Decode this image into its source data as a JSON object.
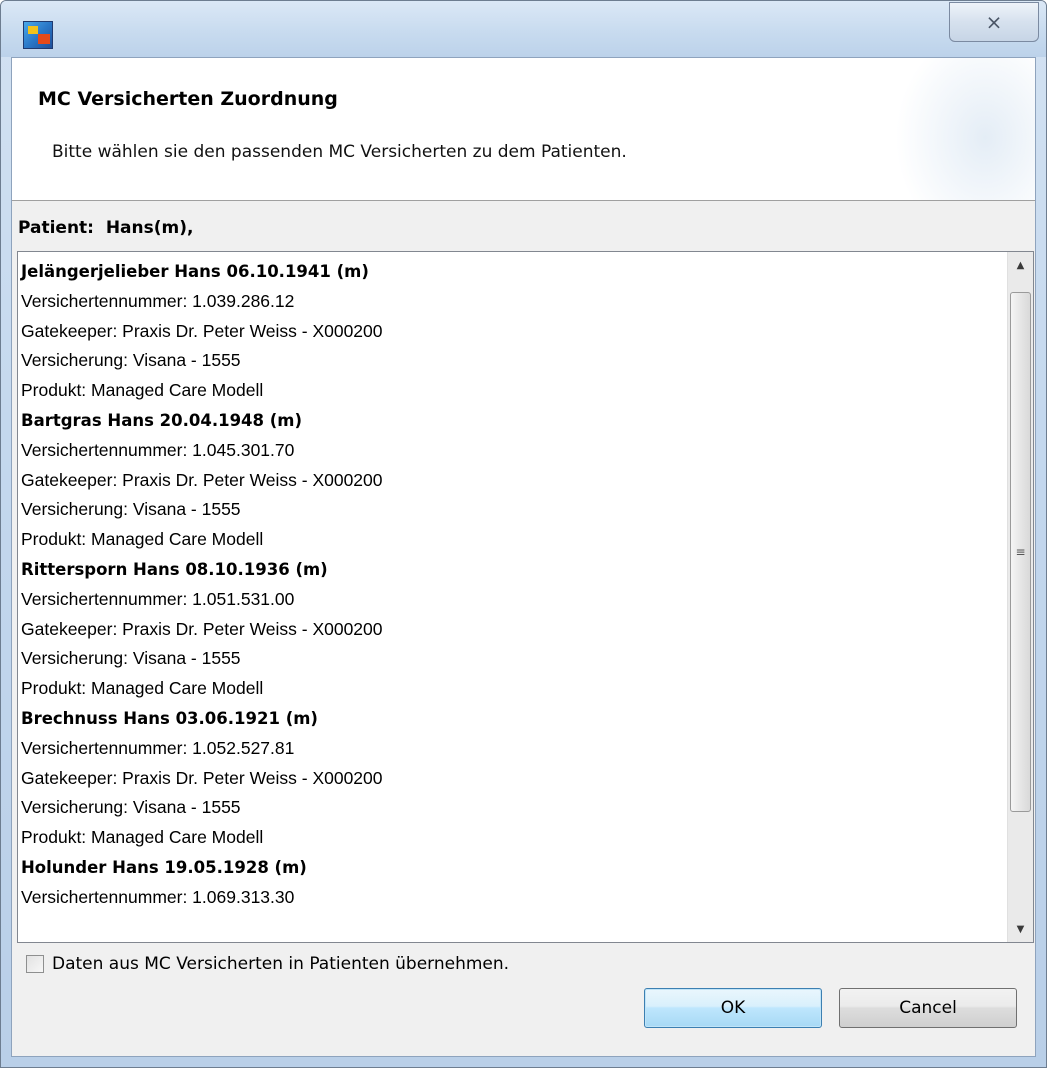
{
  "window": {
    "close_glyph": "⨯"
  },
  "banner": {
    "title": "MC Versicherten Zuordnung",
    "message": "Bitte wählen sie den passenden MC Versicherten zu dem Patienten."
  },
  "patient": {
    "label": "Patient:  Hans(m),"
  },
  "list": {
    "lines": [
      {
        "text": "Jelängerjelieber Hans 06.10.1941 (m)",
        "header": true
      },
      {
        "text": "Versichertennummer: 1.039.286.12",
        "header": false
      },
      {
        "text": "Gatekeeper: Praxis Dr. Peter Weiss - X000200",
        "header": false
      },
      {
        "text": "Versicherung: Visana - 1555",
        "header": false
      },
      {
        "text": "Produkt: Managed Care Modell",
        "header": false
      },
      {
        "text": "Bartgras Hans 20.04.1948 (m)",
        "header": true
      },
      {
        "text": "Versichertennummer: 1.045.301.70",
        "header": false
      },
      {
        "text": "Gatekeeper: Praxis Dr. Peter Weiss - X000200",
        "header": false
      },
      {
        "text": "Versicherung: Visana - 1555",
        "header": false
      },
      {
        "text": "Produkt: Managed Care Modell",
        "header": false
      },
      {
        "text": "Rittersporn Hans 08.10.1936 (m)",
        "header": true
      },
      {
        "text": "Versichertennummer: 1.051.531.00",
        "header": false
      },
      {
        "text": "Gatekeeper: Praxis Dr. Peter Weiss - X000200",
        "header": false
      },
      {
        "text": "Versicherung: Visana - 1555",
        "header": false
      },
      {
        "text": "Produkt: Managed Care Modell",
        "header": false
      },
      {
        "text": "Brechnuss Hans 03.06.1921 (m)",
        "header": true
      },
      {
        "text": "Versichertennummer: 1.052.527.81",
        "header": false
      },
      {
        "text": "Gatekeeper: Praxis Dr. Peter Weiss - X000200",
        "header": false
      },
      {
        "text": "Versicherung: Visana - 1555",
        "header": false
      },
      {
        "text": "Produkt: Managed Care Modell",
        "header": false
      },
      {
        "text": "Holunder Hans 19.05.1928 (m)",
        "header": true
      },
      {
        "text": "Versichertennummer: 1.069.313.30",
        "header": false
      }
    ],
    "scroll_up_glyph": "▲",
    "scroll_down_glyph": "▼",
    "thumb_grip_glyph": "≡"
  },
  "options": {
    "copy_data_label": "Daten aus MC Versicherten in Patienten übernehmen.",
    "copy_data_checked": false
  },
  "buttons": {
    "ok_label": "OK",
    "cancel_label": "Cancel"
  },
  "icons": {
    "app": "app-icon",
    "close": "close-icon",
    "scroll_up": "scroll-up-arrow-icon",
    "scroll_down": "scroll-down-arrow-icon"
  }
}
